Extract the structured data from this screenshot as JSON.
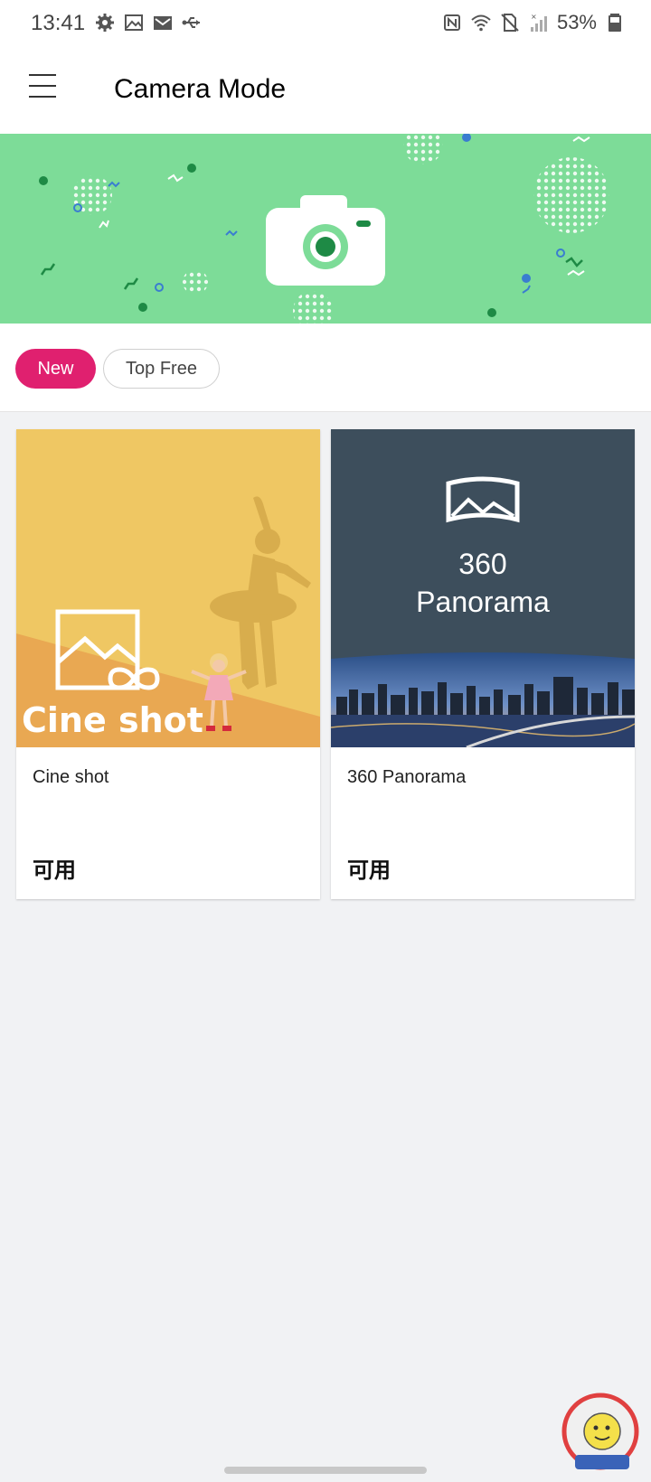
{
  "status_bar": {
    "time": "13:41",
    "left_icons": [
      "settings-icon",
      "image-icon",
      "gmail-icon",
      "usb-icon"
    ],
    "right_icons": [
      "nfc-icon",
      "wifi-icon",
      "no-sim-icon",
      "signal-icon",
      "battery-icon"
    ],
    "battery_percent": "53%"
  },
  "header": {
    "title": "Camera Mode",
    "menu_icon": "hamburger-menu-icon"
  },
  "banner": {
    "icon": "camera-icon",
    "background_color": "#7ddc98"
  },
  "filters": {
    "items": [
      {
        "label": "New",
        "selected": true
      },
      {
        "label": "Top Free",
        "selected": false
      }
    ],
    "accent_color": "#e0206f"
  },
  "cards": [
    {
      "thumbnail_text": "Cine shot",
      "title": "Cine shot",
      "status": "可用"
    },
    {
      "thumbnail_text_line1": "360",
      "thumbnail_text_line2": "Panorama",
      "title": "360 Panorama",
      "status": "可用"
    }
  ]
}
